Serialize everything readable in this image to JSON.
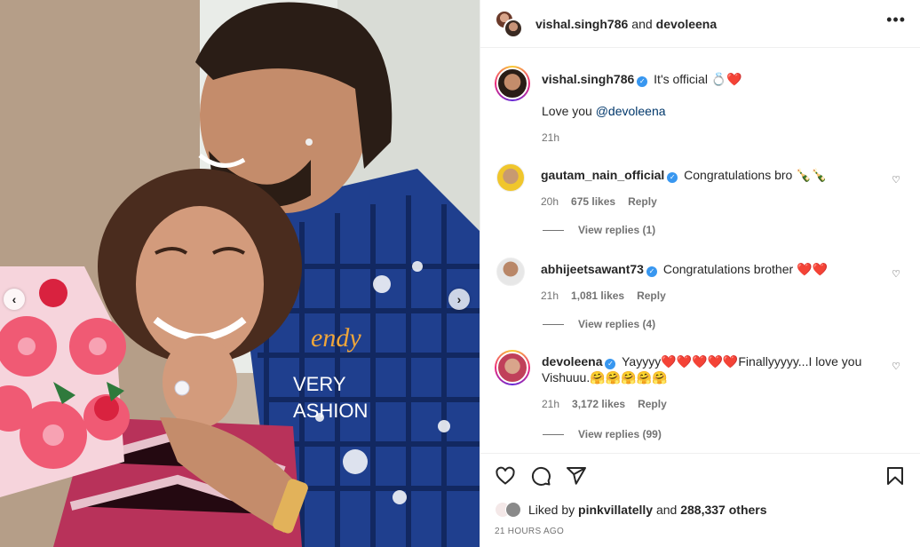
{
  "header": {
    "user1": "vishal.singh786",
    "and": "and",
    "user2": "devoleena",
    "more_icon": "more-horizontal-icon"
  },
  "caption": {
    "username": "vishal.singh786",
    "text": "It's official",
    "line2_prefix": "Love you ",
    "mention": "@devoleena",
    "time": "21h"
  },
  "comments": [
    {
      "username": "gautam_nain_official",
      "text": "Congratulations bro",
      "emoji": "🍾🍾",
      "time": "20h",
      "likes": "675 likes",
      "reply": "Reply",
      "view_replies": "View replies (1)"
    },
    {
      "username": "abhijeetsawant73",
      "text": "Congratulations brother",
      "emoji": "❤️❤️",
      "time": "21h",
      "likes": "1,081 likes",
      "reply": "Reply",
      "view_replies": "View replies (4)"
    },
    {
      "username": "devoleena",
      "text": "Yayyyy❤️❤️❤️❤️❤️Finallyyyyy...I love you",
      "text2": "Vishuuu.🤗🤗🤗🤗🤗",
      "time": "21h",
      "likes": "3,172 likes",
      "reply": "Reply",
      "view_replies": "View replies (99)"
    }
  ],
  "footer": {
    "liked_prefix": "Liked by ",
    "liked_user": "pinkvillatelly",
    "liked_mid": " and ",
    "liked_count": "288,337 others",
    "posted": "21 HOURS AGO"
  },
  "colors": {
    "accent": "#3897f0",
    "heart": "#ed4956",
    "muted": "#737373",
    "mention": "#00376b"
  }
}
